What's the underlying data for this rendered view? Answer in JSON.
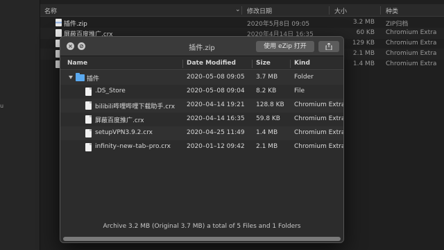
{
  "finder": {
    "sidebar_fragment": "u",
    "columns": {
      "name": "名称",
      "date": "修改日期",
      "size": "大小",
      "kind": "种类"
    },
    "rows": [
      {
        "name": "插件.zip",
        "date": "2020年5月8日 09:05",
        "size": "3.2 MB",
        "kind": "ZIP归档",
        "icon": "zip-icon"
      },
      {
        "name": "屏蔽百度推广.crx",
        "date": "2020年4月14日 16:35",
        "size": "60 KB",
        "kind": "Chromium Extra",
        "icon": "file-icon"
      },
      {
        "name": "",
        "date": "",
        "size": "129 KB",
        "kind": "Chromium Extra",
        "icon": "file-icon"
      },
      {
        "name": "",
        "date": "",
        "size": "2.1 MB",
        "kind": "Chromium Extra",
        "icon": "file-icon"
      },
      {
        "name": "",
        "date": "",
        "size": "1.4 MB",
        "kind": "Chromium Extra",
        "icon": "file-icon"
      }
    ]
  },
  "ezip": {
    "title": "插件.zip",
    "open_button": "使用 eZip 打开",
    "columns": {
      "name": "Name",
      "date": "Date Modified",
      "size": "Size",
      "kind": "Kind"
    },
    "folder": {
      "name": "插件",
      "date": "2020–05–08 09:05",
      "size": "3.7 MB",
      "kind": "Folder"
    },
    "files": [
      {
        "name": ".DS_Store",
        "date": "2020–05–08 09:04",
        "size": "8.2 KB",
        "kind": "File"
      },
      {
        "name": "bilibili哔哩哔哩下载助手.crx",
        "date": "2020–04–14 19:21",
        "size": "128.8 KB",
        "kind": "Chromium Extra"
      },
      {
        "name": "屏蔽百度推广.crx",
        "date": "2020–04–14 16:35",
        "size": "59.8 KB",
        "kind": "Chromium Extra"
      },
      {
        "name": "setupVPN3.9.2.crx",
        "date": "2020–04–25 11:49",
        "size": "1.4 MB",
        "kind": "Chromium Extra"
      },
      {
        "name": "infinity–new–tab–pro.crx",
        "date": "2020–01–12 09:42",
        "size": "2.1 MB",
        "kind": "Chromium Extra"
      }
    ],
    "status": "Archive 3.2 MB (Original 3.7 MB) a total of 5 Files and 1 Folders"
  }
}
